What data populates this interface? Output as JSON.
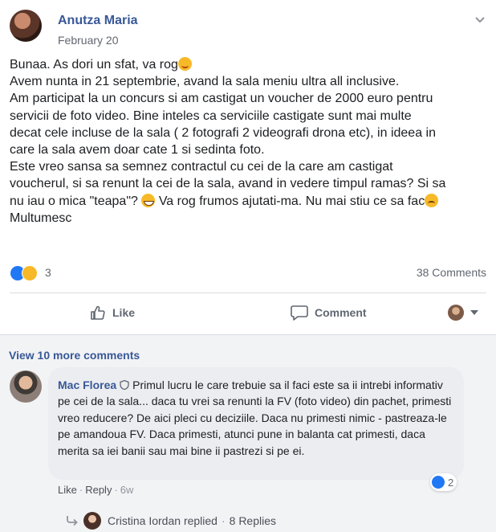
{
  "post": {
    "author": "Anutza Maria",
    "date": "February 20",
    "lines": [
      "Bunaa. As dori un sfat, va rog",
      "Avem nunta in 21 septembrie, avand la sala meniu ultra all inclusive.",
      "Am participat la un concurs si am castigat un voucher de 2000 euro pentru",
      "servicii de foto video. Bine inteles ca serviciile castigate sunt mai multe",
      "decat cele incluse de la sala ( 2 fotografi 2 videografi drona etc), in ideea in",
      "care la sala avem doar cate 1 si sedinta foto.",
      "Este vreo sansa sa semnez contractul cu cei de la care am castigat",
      "voucherul, si sa renunt la cei de la sala, avand in vedere timpul ramas? Si sa",
      "nu iau o mica \"teapa\"?",
      "Va rog frumos ajutati-ma. Nu mai stiu ce sa fac",
      "Multumesc"
    ],
    "reaction_count": "3",
    "comment_count": "38 Comments"
  },
  "actions": {
    "like": "Like",
    "comment": "Comment"
  },
  "comments_section": {
    "view_more": "View 10 more comments",
    "comment": {
      "author": "Mac Florea",
      "text": "Primul lucru le care trebuie sa il faci este sa ii intrebi informativ pe cei de la sala... daca tu vrei sa renunti la FV (foto video) din pachet, primesti vreo reducere? De aici pleci cu deciziile. Daca nu primesti nimic - pastreaza-le pe amandoua FV. Daca primesti, atunci pune in balanta cat primesti, daca merita sa iei banii sau mai bine ii pastrezi si pe ei.",
      "reaction_count": "2",
      "like": "Like",
      "reply": "Reply",
      "time": "6w"
    },
    "reply_summary": {
      "name": "Cristina Iordan",
      "replied": "replied",
      "replies": "8 Replies"
    }
  },
  "colors": {
    "link": "#385898",
    "like_blue": "#2078f4",
    "emoji_yellow": "#f7b928"
  }
}
